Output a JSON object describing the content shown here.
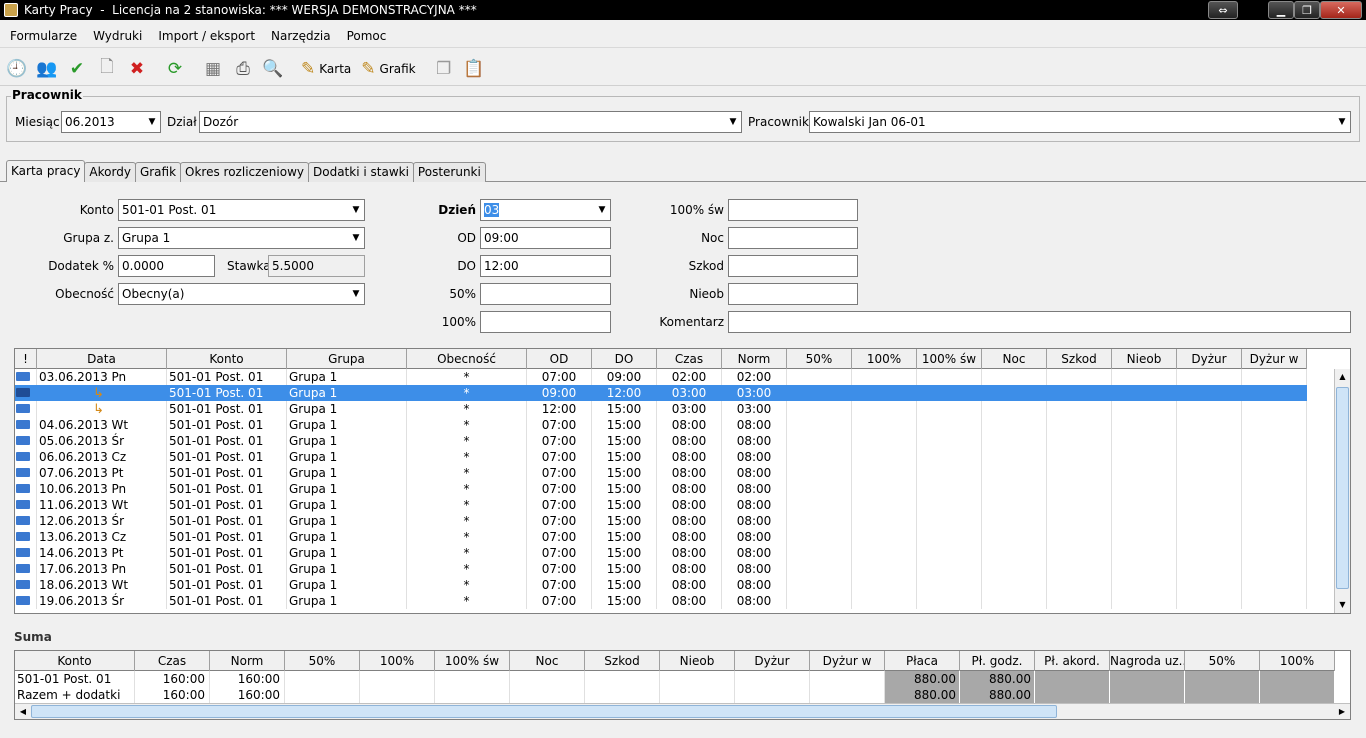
{
  "window": {
    "title": "Karty Pracy  -  Licencja na 2 stanowiska: *** WERSJA DEMONSTRACYJNA ***"
  },
  "menu": [
    "Formularze",
    "Wydruki",
    "Import / eksport",
    "Narzędzia",
    "Pomoc"
  ],
  "toolbar": {
    "karta_label": "Karta",
    "grafik_label": "Grafik"
  },
  "pracownik": {
    "legend": "Pracownik",
    "miesiac_label": "Miesiąc",
    "miesiac_value": "06.2013",
    "dzial_label": "Dział",
    "dzial_value": "Dozór",
    "pracownik_label": "Pracownik",
    "pracownik_value": "Kowalski Jan 06-01"
  },
  "tabs": [
    "Karta pracy",
    "Akordy",
    "Grafik",
    "Okres rozliczeniowy",
    "Dodatki i stawki",
    "Posterunki"
  ],
  "form": {
    "konto_label": "Konto",
    "konto_value": "501-01  Post. 01",
    "grupa_label": "Grupa z.",
    "grupa_value": "Grupa 1",
    "dodatek_label": "Dodatek %",
    "dodatek_value": "0.0000",
    "stawka_label": "Stawka",
    "stawka_value": "5.5000",
    "obecnosc_label": "Obecność",
    "obecnosc_value": "Obecny(a)",
    "dzien_label": "Dzień",
    "dzien_value": "03",
    "od_label": "OD",
    "od_value": "09:00",
    "do_label": "DO",
    "do_value": "12:00",
    "p50_label": "50%",
    "p50_value": "",
    "p100_label": "100%",
    "p100_value": "",
    "p100sw_label": "100% św",
    "p100sw_value": "",
    "noc_label": "Noc",
    "noc_value": "",
    "szkod_label": "Szkod",
    "szkod_value": "",
    "nieob_label": "Nieob",
    "nieob_value": "",
    "komentarz_label": "Komentarz",
    "komentarz_value": ""
  },
  "table": {
    "columns": [
      "!",
      "Data",
      "Konto",
      "Grupa",
      "Obecność",
      "OD",
      "DO",
      "Czas",
      "Norm",
      "50%",
      "100%",
      "100% św",
      "Noc",
      "Szkod",
      "Nieob",
      "Dyżur",
      "Dyżur w"
    ],
    "rows": [
      {
        "data": "03.06.2013 Pn",
        "konto": "501-01  Post. 01",
        "grupa": "Grupa 1",
        "obecnosc": "*",
        "od": "07:00",
        "do": "09:00",
        "czas": "02:00",
        "norm": "02:00",
        "sub": false,
        "selected": false
      },
      {
        "data": "",
        "konto": "501-01  Post. 01",
        "grupa": "Grupa 1",
        "obecnosc": "*",
        "od": "09:00",
        "do": "12:00",
        "czas": "03:00",
        "norm": "03:00",
        "sub": true,
        "selected": true
      },
      {
        "data": "",
        "konto": "501-01  Post. 01",
        "grupa": "Grupa 1",
        "obecnosc": "*",
        "od": "12:00",
        "do": "15:00",
        "czas": "03:00",
        "norm": "03:00",
        "sub": true,
        "selected": false
      },
      {
        "data": "04.06.2013 Wt",
        "konto": "501-01  Post. 01",
        "grupa": "Grupa 1",
        "obecnosc": "*",
        "od": "07:00",
        "do": "15:00",
        "czas": "08:00",
        "norm": "08:00",
        "sub": false,
        "selected": false
      },
      {
        "data": "05.06.2013 Śr",
        "konto": "501-01  Post. 01",
        "grupa": "Grupa 1",
        "obecnosc": "*",
        "od": "07:00",
        "do": "15:00",
        "czas": "08:00",
        "norm": "08:00",
        "sub": false,
        "selected": false
      },
      {
        "data": "06.06.2013 Cz",
        "konto": "501-01  Post. 01",
        "grupa": "Grupa 1",
        "obecnosc": "*",
        "od": "07:00",
        "do": "15:00",
        "czas": "08:00",
        "norm": "08:00",
        "sub": false,
        "selected": false
      },
      {
        "data": "07.06.2013 Pt",
        "konto": "501-01  Post. 01",
        "grupa": "Grupa 1",
        "obecnosc": "*",
        "od": "07:00",
        "do": "15:00",
        "czas": "08:00",
        "norm": "08:00",
        "sub": false,
        "selected": false
      },
      {
        "data": "10.06.2013 Pn",
        "konto": "501-01  Post. 01",
        "grupa": "Grupa 1",
        "obecnosc": "*",
        "od": "07:00",
        "do": "15:00",
        "czas": "08:00",
        "norm": "08:00",
        "sub": false,
        "selected": false
      },
      {
        "data": "11.06.2013 Wt",
        "konto": "501-01  Post. 01",
        "grupa": "Grupa 1",
        "obecnosc": "*",
        "od": "07:00",
        "do": "15:00",
        "czas": "08:00",
        "norm": "08:00",
        "sub": false,
        "selected": false
      },
      {
        "data": "12.06.2013 Śr",
        "konto": "501-01  Post. 01",
        "grupa": "Grupa 1",
        "obecnosc": "*",
        "od": "07:00",
        "do": "15:00",
        "czas": "08:00",
        "norm": "08:00",
        "sub": false,
        "selected": false
      },
      {
        "data": "13.06.2013 Cz",
        "konto": "501-01  Post. 01",
        "grupa": "Grupa 1",
        "obecnosc": "*",
        "od": "07:00",
        "do": "15:00",
        "czas": "08:00",
        "norm": "08:00",
        "sub": false,
        "selected": false
      },
      {
        "data": "14.06.2013 Pt",
        "konto": "501-01  Post. 01",
        "grupa": "Grupa 1",
        "obecnosc": "*",
        "od": "07:00",
        "do": "15:00",
        "czas": "08:00",
        "norm": "08:00",
        "sub": false,
        "selected": false
      },
      {
        "data": "17.06.2013 Pn",
        "konto": "501-01  Post. 01",
        "grupa": "Grupa 1",
        "obecnosc": "*",
        "od": "07:00",
        "do": "15:00",
        "czas": "08:00",
        "norm": "08:00",
        "sub": false,
        "selected": false
      },
      {
        "data": "18.06.2013 Wt",
        "konto": "501-01  Post. 01",
        "grupa": "Grupa 1",
        "obecnosc": "*",
        "od": "07:00",
        "do": "15:00",
        "czas": "08:00",
        "norm": "08:00",
        "sub": false,
        "selected": false
      },
      {
        "data": "19.06.2013 Śr",
        "konto": "501-01  Post. 01",
        "grupa": "Grupa 1",
        "obecnosc": "*",
        "od": "07:00",
        "do": "15:00",
        "czas": "08:00",
        "norm": "08:00",
        "sub": false,
        "selected": false
      }
    ]
  },
  "suma": {
    "label": "Suma",
    "columns": [
      "Konto",
      "Czas",
      "Norm",
      "50%",
      "100%",
      "100% św",
      "Noc",
      "Szkod",
      "Nieob",
      "Dyżur",
      "Dyżur w",
      "Płaca",
      "Pł. godz.",
      "Pł. akord.",
      "Nagroda uz...",
      "50%",
      "100%"
    ],
    "rows": [
      {
        "konto": "501-01  Post. 01",
        "czas": "160:00",
        "norm": "160:00",
        "placa": "880.00",
        "pl_godz": "880.00"
      },
      {
        "konto": "Razem + dodatki",
        "czas": "160:00",
        "norm": "160:00",
        "placa": "880.00",
        "pl_godz": "880.00"
      }
    ]
  }
}
